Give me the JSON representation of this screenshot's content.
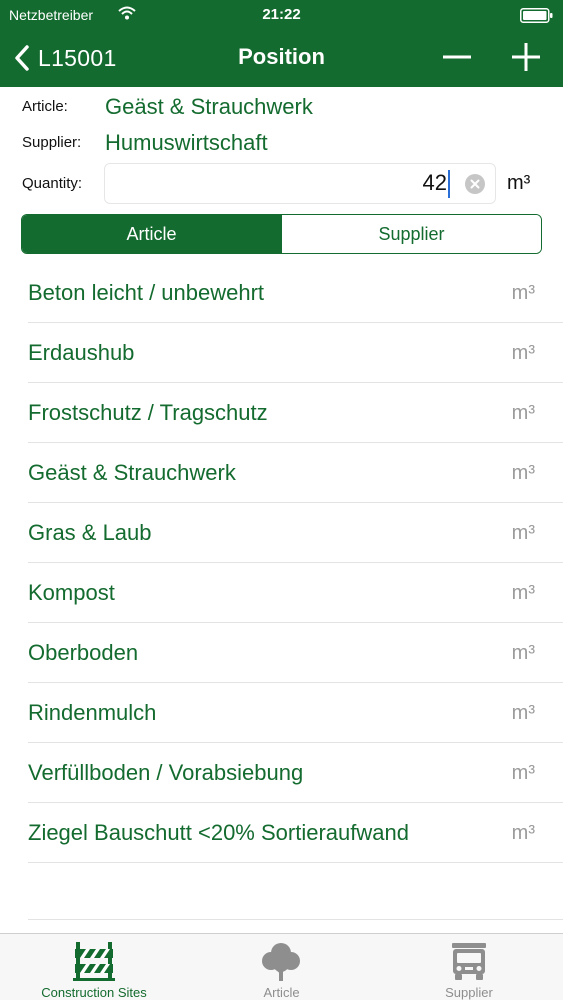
{
  "status_bar": {
    "carrier": "Netzbetreiber",
    "time": "21:22"
  },
  "nav": {
    "back_label": "L15001",
    "title": "Position"
  },
  "form": {
    "article_label": "Article:",
    "article_value": "Geäst & Strauchwerk",
    "supplier_label": "Supplier:",
    "supplier_value": "Humuswirtschaft",
    "quantity_label": "Quantity:",
    "quantity_value": "42",
    "unit": "m³"
  },
  "segmented": {
    "active": "Article",
    "inactive": "Supplier"
  },
  "items": [
    {
      "name": "Beton leicht / unbewehrt",
      "unit": "m³"
    },
    {
      "name": "Erdaushub",
      "unit": "m³"
    },
    {
      "name": "Frostschutz / Tragschutz",
      "unit": "m³"
    },
    {
      "name": "Geäst & Strauchwerk",
      "unit": "m³"
    },
    {
      "name": "Gras & Laub",
      "unit": "m³"
    },
    {
      "name": "Kompost",
      "unit": "m³"
    },
    {
      "name": "Oberboden",
      "unit": "m³"
    },
    {
      "name": "Rindenmulch",
      "unit": "m³"
    },
    {
      "name": "Verfüllboden / Vorabsiebung",
      "unit": "m³"
    },
    {
      "name": "Ziegel Bauschutt <20% Sortieraufwand",
      "unit": "m³"
    }
  ],
  "tabs": [
    {
      "label": "Construction Sites",
      "icon": "construction-barrier-icon",
      "active": true
    },
    {
      "label": "Article",
      "icon": "tree-icon",
      "active": false
    },
    {
      "label": "Supplier",
      "icon": "truck-icon",
      "active": false
    }
  ],
  "colors": {
    "brand": "#146b2f",
    "muted": "#9b9b9b",
    "tab_inactive": "#8e8e8e"
  }
}
